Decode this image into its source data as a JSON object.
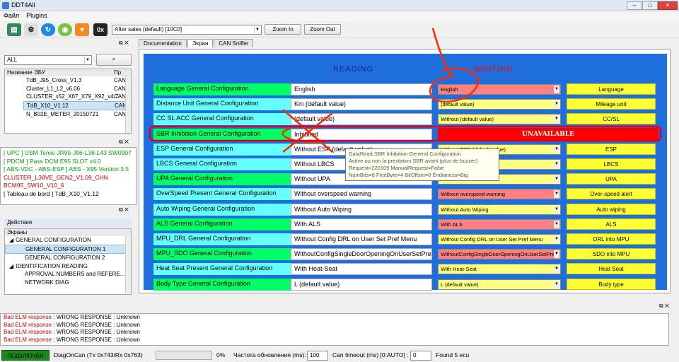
{
  "app": {
    "title": "DDT4All"
  },
  "menu": [
    "Файл",
    "Plugins"
  ],
  "toolbar": {
    "mode_label": "After sales (default) [10C0]",
    "zoom_in": "Zoom In",
    "zoom_out": "Zoom Out",
    "hex_label": "0x"
  },
  "left": {
    "filter_value": "ALL",
    "ecu_header": [
      "Название ЭБУ",
      "Пр"
    ],
    "ecus": [
      [
        "TdB_J95_Cross_V1.3",
        "CAN"
      ],
      [
        "Cluster_L1_L2_v6.06",
        "CAN"
      ],
      [
        "CLUSTER_x52_X67_X79_X92_v4.7",
        "CAN"
      ],
      [
        "TdB_X10_V1.12",
        "CAN"
      ],
      [
        "N_B02E_METER_20150721",
        "CAN"
      ]
    ],
    "modules": [
      {
        "text": "[ UPC ] USM Temic JR95-J96-L38-L43 SW0907",
        "color": "#00a000"
      },
      {
        "text": "[ PDCM ] Pass DCM E95 SLOT v4.0",
        "color": "#00a000"
      },
      {
        "text": "[ ABS-VDC - ABS-ESP ] ABS - X95 Version 3.5",
        "color": "#00a000"
      },
      {
        "text": "CLUSTER_L38VE_GEN2_V1.09_CHN",
        "color": "#c00000"
      },
      {
        "text": "BCM95_SW10_V10_6",
        "color": "#c00000"
      },
      {
        "text": "[ Tableau de bord ] TdB_X10_V1.12",
        "color": "#000000"
      }
    ],
    "actions_header": "Действия",
    "screens_header": "Экраны",
    "tree": [
      {
        "text": "GENERAL CONFIGURATION",
        "level": 0,
        "open": true
      },
      {
        "text": "GENERAL CONFIGURATION 1",
        "level": 1,
        "selected": true
      },
      {
        "text": "GENERAL CONFIGURATION 2",
        "level": 1
      },
      {
        "text": "IDENTIFICATION READING",
        "level": 0,
        "open": true
      },
      {
        "text": "APPROVAL NUMBERS and REFERE...",
        "level": 1
      },
      {
        "text": "NETWORK DIAG",
        "level": 1
      }
    ]
  },
  "tabs": [
    "Documentation",
    "Экран",
    "CAN Sniffer"
  ],
  "active_tab": 1,
  "screen": {
    "reading_title": "READING",
    "writing_title": "WRITING",
    "rows": [
      {
        "label": "Language General Configuration",
        "label_bg": "#00ff66",
        "value": "English",
        "write": "English",
        "write_bg": "#ff8080",
        "button": "Language"
      },
      {
        "label": "Distance Unit General Configuration",
        "label_bg": "#66ffff",
        "value": "Km (default value)",
        "write": "(default value)",
        "write_bg": "#ffff80",
        "button": "Mileage unit"
      },
      {
        "label": "CC SL ACC General Configuration",
        "label_bg": "#66ffff",
        "value": "(default value)",
        "write": "Without (default value)",
        "write_bg": "#ffff80",
        "button": "CC/SL"
      },
      {
        "label": "SBR Inhibition General Configuration",
        "label_bg": "#00ff66",
        "value": "Inhibited",
        "write": "UNAVAILABLE",
        "write_bg": "#ff0000",
        "button": ""
      },
      {
        "label": "ESP General Configuration",
        "label_bg": "#66ffff",
        "value": "Without ESP (default value)",
        "write": "Without ESP (default value)",
        "write_bg": "#ffff80",
        "button": "ESP"
      },
      {
        "label": "LBCS General Configuration",
        "label_bg": "#66ffff",
        "value": "Without LBCS",
        "write": "Without LBCS",
        "write_bg": "#ffff80",
        "button": "LBCS"
      },
      {
        "label": "UPA General Configuration",
        "label_bg": "#00ff66",
        "value": "Without UPA",
        "write": "Without UPA",
        "write_bg": "#ffff80",
        "button": "UPA"
      },
      {
        "label": "OverSpeed Present General Configuration",
        "label_bg": "#66ffff",
        "value": "Without overspeed warning",
        "write": "Without overspeed warning",
        "write_bg": "#ff8080",
        "button": "Over-speed alert"
      },
      {
        "label": "Auto Wiping General Configuration",
        "label_bg": "#66ffff",
        "value": "Without Auto Wiping",
        "write": "Without Auto Wiping",
        "write_bg": "#ffff80",
        "button": "Auto wiping"
      },
      {
        "label": "ALS General Configuration",
        "label_bg": "#00ff66",
        "value": "With ALS",
        "write": "With ALS",
        "write_bg": "#ff8080",
        "button": "ALS"
      },
      {
        "label": "MPU_DRL General Configuration",
        "label_bg": "#66ffff",
        "value": "Without Config DRL on User Set Pref Menu",
        "write": "Without Config DRL on User Set Pref Menu",
        "write_bg": "#ffff80",
        "button": "DRL into MPU"
      },
      {
        "label": "MPU_SDO General Configuration",
        "label_bg": "#00ff66",
        "value": "WithoutConfigSingleDoorOpeningOnUserSetPref",
        "write": "WithoutConfigSingleDoorOpeningOnUserSetPref",
        "write_bg": "#ff8080",
        "button": "SDO into MPU"
      },
      {
        "label": "Heat Seat Present General Configuration",
        "label_bg": "#66ffff",
        "value": "With Heat-Seat",
        "write": "With Heat-Seat",
        "write_bg": "#ffff80",
        "button": "Heat Seat"
      },
      {
        "label": "Body Type General Configuration",
        "label_bg": "#00ff66",
        "value": "L (default value)",
        "write": "L (default value)",
        "write_bg": "#ffff80",
        "button": "Body type"
      }
    ],
    "tooltip": [
      "DataRead.SBR Inhibition General Configuration",
      "Active ou non la prestation SBR avant (plus de buzzer)",
      "Request=220109 ManualRequest=False",
      "NumBits=8 FirstByte=4 BitOffset=0 Endianess=Big"
    ]
  },
  "log": {
    "lines": [
      {
        "prefix": "Bad ELM response",
        "text": " : WRONG RESPONSE : Unknown"
      },
      {
        "prefix": "Bad ELM response",
        "text": " : WRONG RESPONSE : Unknown"
      },
      {
        "prefix": "Bad ELM response",
        "text": " : WRONG RESPONSE : Unknown"
      },
      {
        "prefix": "Bad ELM response",
        "text": " : WRONG RESPONSE : Unknown"
      }
    ]
  },
  "status": {
    "connected": "ПОДКЛЮЧЕН",
    "bus": "DiagOnCan (Tx 0x743/Rx 0x763)",
    "progress_text": "0%",
    "progress": 0,
    "refresh_label": "Частота обновления (ms):",
    "refresh_value": "100",
    "can_timeout_label": "Can timeout (ms) [0:AUTO] :",
    "can_timeout_value": "0",
    "found": "Found 5 ecu"
  },
  "colors": {
    "screen_bg": "#1e6fdd",
    "title_text": "#1a1aa0",
    "writing_text": "#ff0000",
    "log_red": "#c00000",
    "connected_bg": "#1a8a1a"
  }
}
